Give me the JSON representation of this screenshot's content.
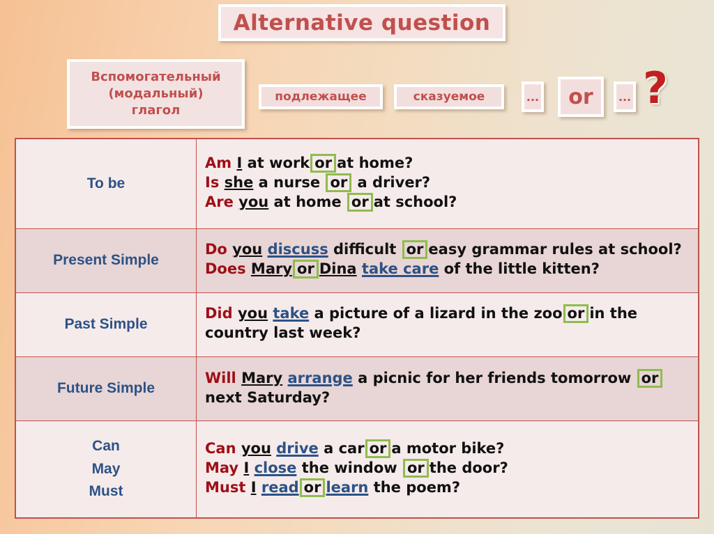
{
  "header": {
    "title": "Alternative question",
    "aux_box": "Вспомогательный (модальный) глагол",
    "aux_line1": "Вспомогательный",
    "aux_line2": "(модальный)",
    "aux_line3": "глагол",
    "chip_subject": "подлежащее",
    "chip_predicate": "сказуемое",
    "chip_dots_left": "...",
    "chip_or": "or",
    "chip_dots_right": "...",
    "question_mark": "?"
  },
  "colors": {
    "title_text": "#c0504d",
    "chip_bg": "#f3dede",
    "table_border": "#c0504d",
    "row_light": "#f6ebeb",
    "row_dark": "#e8d5d5",
    "tense_label": "#2c5286",
    "auxiliary": "#9e0f17",
    "verb": "#2c5286",
    "or_highlight": "#8fbc4e",
    "question_mark": "#c0201f"
  },
  "table": {
    "rows": [
      {
        "tense": "To be",
        "sentences": [
          {
            "parts": [
              {
                "t": "Am",
                "style": "aux"
              },
              {
                "t": " ",
                "style": "plain"
              },
              {
                "t": "I",
                "style": "subj"
              },
              {
                "t": " at work",
                "style": "plain"
              },
              {
                "t": "or",
                "style": "orbox"
              },
              {
                "t": "at home?",
                "style": "plain"
              }
            ]
          },
          {
            "parts": [
              {
                "t": "Is",
                "style": "aux"
              },
              {
                "t": " ",
                "style": "plain"
              },
              {
                "t": "she",
                "style": "subj"
              },
              {
                "t": " a nurse ",
                "style": "plain"
              },
              {
                "t": "or",
                "style": "orbox"
              },
              {
                "t": " a driver?",
                "style": "plain"
              }
            ]
          },
          {
            "parts": [
              {
                "t": "Are",
                "style": "aux"
              },
              {
                "t": " ",
                "style": "plain"
              },
              {
                "t": "you",
                "style": "subj"
              },
              {
                "t": " at home ",
                "style": "plain"
              },
              {
                "t": "or",
                "style": "orbox"
              },
              {
                "t": "at school?",
                "style": "plain"
              }
            ]
          }
        ]
      },
      {
        "tense": "Present Simple",
        "sentences": [
          {
            "parts": [
              {
                "t": "Do",
                "style": "aux"
              },
              {
                "t": " ",
                "style": "plain"
              },
              {
                "t": "you",
                "style": "subj"
              },
              {
                "t": " ",
                "style": "plain"
              },
              {
                "t": "discuss",
                "style": "verb"
              },
              {
                "t": " difficult ",
                "style": "plain"
              },
              {
                "t": "or",
                "style": "orbox"
              },
              {
                "t": "easy grammar rules at school?",
                "style": "plain"
              }
            ]
          },
          {
            "parts": [
              {
                "t": "Does",
                "style": "aux"
              },
              {
                "t": " ",
                "style": "plain"
              },
              {
                "t": "Mary",
                "style": "subj"
              },
              {
                "t": "",
                "style": "plain"
              },
              {
                "t": "or",
                "style": "orbox"
              },
              {
                "t": "",
                "style": "plain"
              },
              {
                "t": "Dina",
                "style": "subj"
              },
              {
                "t": " ",
                "style": "plain"
              },
              {
                "t": "take care",
                "style": "verb"
              },
              {
                "t": " of the little kitten?",
                "style": "plain"
              }
            ]
          }
        ]
      },
      {
        "tense": "Past Simple",
        "sentences": [
          {
            "parts": [
              {
                "t": "Did",
                "style": "aux"
              },
              {
                "t": " ",
                "style": "plain"
              },
              {
                "t": "you",
                "style": "subj"
              },
              {
                "t": " ",
                "style": "plain"
              },
              {
                "t": "take",
                "style": "verb"
              },
              {
                "t": " a picture of a lizard in the zoo",
                "style": "plain"
              },
              {
                "t": "or",
                "style": "orbox"
              },
              {
                "t": "in the country last week?",
                "style": "plain"
              }
            ]
          }
        ]
      },
      {
        "tense": "Future Simple",
        "sentences": [
          {
            "parts": [
              {
                "t": "Will",
                "style": "aux"
              },
              {
                "t": " ",
                "style": "plain"
              },
              {
                "t": "Mary",
                "style": "subj"
              },
              {
                "t": " ",
                "style": "plain"
              },
              {
                "t": "arrange",
                "style": "verb"
              },
              {
                "t": " a picnic for her friends tomorrow ",
                "style": "plain"
              },
              {
                "t": "or",
                "style": "orbox"
              },
              {
                "t": "next Saturday?",
                "style": "plain"
              }
            ]
          }
        ]
      },
      {
        "tense": "Can May Must",
        "tense_lines": [
          "Can",
          "May",
          "Must"
        ],
        "sentences": [
          {
            "parts": [
              {
                "t": "Can",
                "style": "aux"
              },
              {
                "t": " ",
                "style": "plain"
              },
              {
                "t": "you",
                "style": "subj"
              },
              {
                "t": " ",
                "style": "plain"
              },
              {
                "t": "drive",
                "style": "verb"
              },
              {
                "t": " a car",
                "style": "plain"
              },
              {
                "t": "or",
                "style": "orbox"
              },
              {
                "t": "a motor bike?",
                "style": "plain"
              }
            ]
          },
          {
            "parts": [
              {
                "t": "May",
                "style": "aux"
              },
              {
                "t": " ",
                "style": "plain"
              },
              {
                "t": "I",
                "style": "subj"
              },
              {
                "t": " ",
                "style": "plain"
              },
              {
                "t": "close",
                "style": "verb"
              },
              {
                "t": " the window ",
                "style": "plain"
              },
              {
                "t": "or",
                "style": "orbox"
              },
              {
                "t": "the door?",
                "style": "plain"
              }
            ]
          },
          {
            "parts": [
              {
                "t": "Must",
                "style": "aux"
              },
              {
                "t": " ",
                "style": "plain"
              },
              {
                "t": "I",
                "style": "subj"
              },
              {
                "t": " ",
                "style": "plain"
              },
              {
                "t": "read",
                "style": "verb"
              },
              {
                "t": "",
                "style": "plain"
              },
              {
                "t": "or",
                "style": "orbox"
              },
              {
                "t": "",
                "style": "plain"
              },
              {
                "t": "learn",
                "style": "verb"
              },
              {
                "t": " the poem?",
                "style": "plain"
              }
            ]
          }
        ]
      }
    ]
  }
}
